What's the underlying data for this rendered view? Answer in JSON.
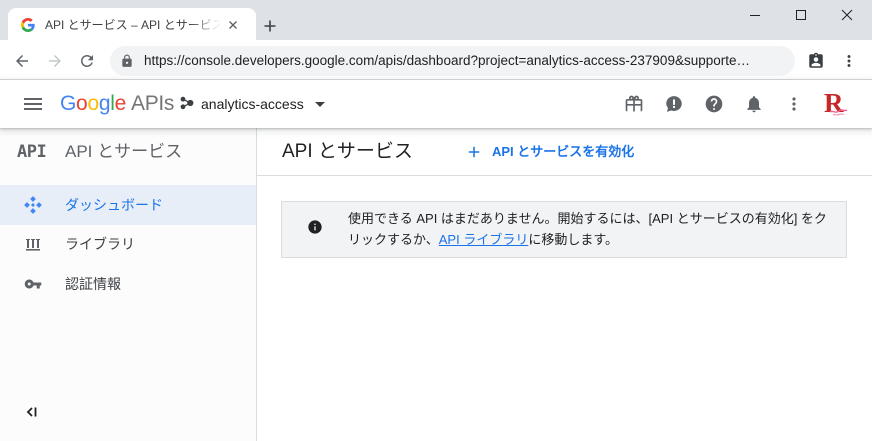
{
  "browser": {
    "tab": {
      "favicon": "google-g-icon",
      "title": "API とサービス – API とサービス – ana",
      "close_icon": "close-icon"
    },
    "new_tab_icon": "plus-icon",
    "window_controls": [
      "minimize-icon",
      "maximize-icon",
      "close-icon"
    ],
    "toolbar": {
      "back_icon": "arrow-back-icon",
      "forward_icon": "arrow-forward-icon",
      "reload_icon": "reload-icon",
      "lock_icon": "lock-icon",
      "url": "https://console.developers.google.com/apis/dashboard?project=analytics-access-237909&supporte…",
      "extension_icon": "assignment-ind-icon",
      "menu_icon": "more-vert-icon"
    }
  },
  "header": {
    "menu_icon": "hamburger-menu-icon",
    "logo": {
      "letters": [
        {
          "char": "G",
          "color": "#4285f4"
        },
        {
          "char": "o",
          "color": "#ea4335"
        },
        {
          "char": "o",
          "color": "#fbbc05"
        },
        {
          "char": "g",
          "color": "#4285f4"
        },
        {
          "char": "l",
          "color": "#34a853"
        },
        {
          "char": "e",
          "color": "#ea4335"
        }
      ],
      "suffix": "APIs"
    },
    "project": {
      "icon": "project-icon",
      "name": "analytics-access",
      "dropdown_icon": "arrow-drop-down-icon"
    },
    "actions": [
      "gift-icon",
      "feedback-icon",
      "help-icon",
      "notifications-icon",
      "more-vert-icon"
    ],
    "avatar": {
      "letter": "R"
    }
  },
  "sidebar": {
    "product_icon_text": "API",
    "title": "API とサービス",
    "items": [
      {
        "label": "ダッシュボード",
        "icon": "dashboard-icon",
        "selected": true
      },
      {
        "label": "ライブラリ",
        "icon": "library-icon",
        "selected": false
      },
      {
        "label": "認証情報",
        "icon": "key-icon",
        "selected": false
      }
    ],
    "collapse_icon": "collapse-sidebar-icon"
  },
  "main": {
    "title": "API とサービス",
    "enable_button": {
      "icon": "add-icon",
      "label": "API とサービスを有効化"
    },
    "notice": {
      "icon": "info-icon",
      "text_before": "使用できる API はまだありません。開始するには、[API とサービスの有効化] をクリックするか、",
      "link": "API ライブラリ",
      "text_after": "に移動します。"
    }
  },
  "colors": {
    "accent": "#1a73e8",
    "titlebar": "#dee1e6",
    "selected_nav_bg": "#e8eef8",
    "notice_bg": "#f1f3f4",
    "avatar_red": "#c62828"
  }
}
